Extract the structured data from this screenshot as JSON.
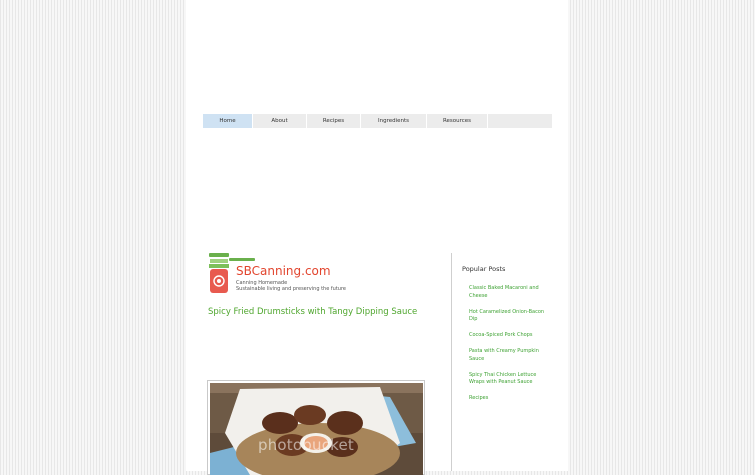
{
  "nav": {
    "items": [
      {
        "label": "Home",
        "active": true
      },
      {
        "label": "About",
        "active": false
      },
      {
        "label": "Recipes",
        "active": false
      },
      {
        "label": "Ingredients",
        "active": false
      },
      {
        "label": "Resources",
        "active": false
      },
      {
        "label": "",
        "active": false
      }
    ]
  },
  "logo": {
    "name": "SBCanning.com",
    "tagline1": "Canning Homemade",
    "tagline2": "Sustainable living and preserving the future"
  },
  "post": {
    "title": "Spicy Fried Drumsticks with Tangy Dipping Sauce"
  },
  "sidebar": {
    "title": "Popular Posts",
    "items": [
      "Classic Baked Macaroni and Cheese",
      "Hot Caramelized Onion-Bacon Dip",
      "Cocoa-Spiced Pork Chops",
      "Pasta with Creamy Pumpkin Sauce",
      "Spicy Thai Chicken Lettuce Wraps with Peanut Sauce",
      "Recipes"
    ]
  },
  "photo": {
    "watermark": "photobucket"
  },
  "colors": {
    "accent": "#4fa62e",
    "brand": "#e2452e",
    "nav_active": "#cfe2f3"
  }
}
